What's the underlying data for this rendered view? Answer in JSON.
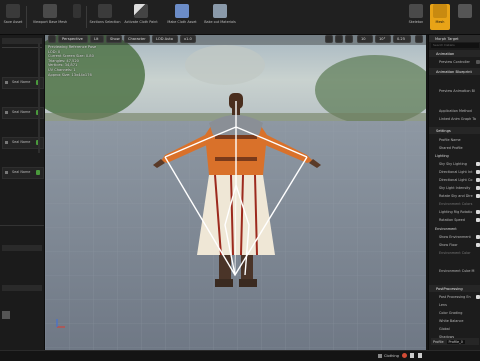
{
  "toolbar": {
    "save_label": "Save Asset",
    "viewport_label": "Viewport Base Mesh",
    "preview_label": "Preview",
    "sections_label": "Sections Selection",
    "activate_cloth_label": "Activate Cloth Paint",
    "make_cloth_label": "Make Cloth Asset",
    "bake_label": "Bake out Materials",
    "skeleton_label": "Skeleton",
    "mesh_label": "Mesh"
  },
  "viewport": {
    "perspective": "Perspective",
    "lit": "Lit",
    "show": "Show",
    "character": "Character",
    "lod": "LOD Auto",
    "speed": "x1.0",
    "snap": "10",
    "angle": "10°",
    "scale": "0.25",
    "stats": [
      "Previewing Reference Pose",
      "LOD: 0",
      "Current Screen Size: 0.80",
      "Triangles: 47,520",
      "Vertices: 34,871",
      "UV Channels: 1",
      "Approx Size: 13x44x176"
    ],
    "view_options": "View Options",
    "time_value": "0"
  },
  "right_panel": {
    "tab_title": "Morph Target",
    "search_placeholder": "Search Details",
    "sections": [
      {
        "title": "Animation",
        "rows": [
          {
            "label": "Preview Controller"
          }
        ]
      },
      {
        "title": "Animation Blueprint",
        "rows": [
          {
            "label": "Preview Animation Bl"
          },
          {
            "label": "Application Method"
          },
          {
            "label": "Linked Anim Graph Ta"
          }
        ]
      },
      {
        "title": "Settings",
        "rows": [
          {
            "label": "Profile Name"
          },
          {
            "label": "Shared Profile"
          },
          {
            "label": "Lighting"
          },
          {
            "label": "Sky Sky Lighting"
          },
          {
            "label": "Directional Light Int"
          },
          {
            "label": "Directional Light Co"
          },
          {
            "label": "Sky Light Intensity"
          },
          {
            "label": "Rotate Sky and Dire"
          },
          {
            "label": "Environment Colors"
          },
          {
            "label": "Lighting Rig Rotatio"
          },
          {
            "label": "Rotation Speed"
          },
          {
            "label": "Environment"
          },
          {
            "label": "Show Environment"
          },
          {
            "label": "Show Floor"
          },
          {
            "label": "Environment Color"
          },
          {
            "label": "Environment Cube M"
          }
        ]
      },
      {
        "title": "PostProcessing",
        "rows": [
          {
            "label": "Post Processing En"
          },
          {
            "label": "Lens"
          },
          {
            "label": "Color Grading"
          },
          {
            "label": "White Balance"
          },
          {
            "label": "Global"
          },
          {
            "label": "Shadows"
          }
        ]
      }
    ],
    "profile_label": "Profile",
    "profile_value": "Profile_0"
  },
  "left_panel": {
    "items": [
      "Seal Name",
      "Seal Name",
      "Seal Name",
      "Seal Name",
      "Seal Name"
    ]
  },
  "bottom_bar": {
    "tab": "Clothing",
    "tab_label": "Clothing"
  },
  "colors": {
    "accent": "#e8a317",
    "skeleton_white": "#ffffff",
    "floor": "#7f8a99"
  }
}
